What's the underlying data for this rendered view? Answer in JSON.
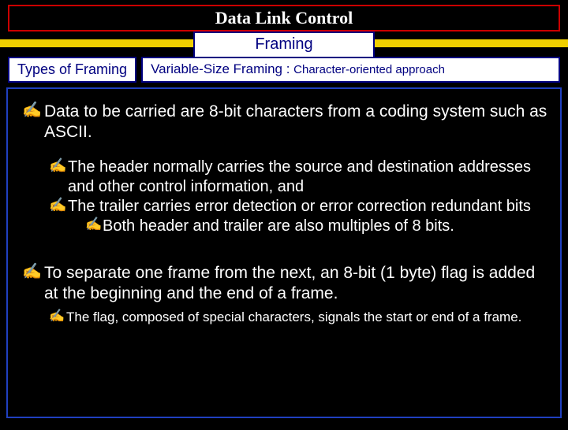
{
  "title": "Data Link Control",
  "framing": "Framing",
  "tab_left": "Types of  Framing",
  "tab_right_main": "Variable-Size Framing :",
  "tab_right_sub": "Character-oriented approach",
  "point1": "Data to be carried are 8-bit characters from a coding system such as ASCII.",
  "sub1_pre": "The ",
  "sub1_word": "header",
  "sub1_post": " normally carries the source and destination addresses and other control information, and",
  "sub2_pre": "The ",
  "sub2_word": "trailer",
  "sub2_post": " carries error detection or error correction redundant bits",
  "sub3": "Both header and trailer are also multiples of 8 bits.",
  "point2": "To separate one frame from the next, an 8-bit (1 byte) flag is added at the beginning and the end of a frame.",
  "tail_pre": "The ",
  "tail_word": "flag",
  "tail_post": ", composed of special characters, signals the start or end of a frame."
}
